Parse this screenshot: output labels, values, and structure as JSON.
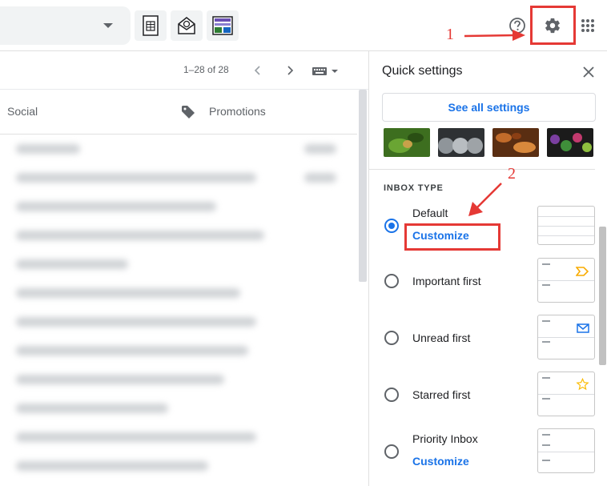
{
  "toolbar": {
    "pager_text": "1–28 of 28"
  },
  "tabs": [
    {
      "label": "Social"
    },
    {
      "label": "Promotions"
    }
  ],
  "quick_settings": {
    "title": "Quick settings",
    "see_all_label": "See all settings",
    "inbox_type_heading": "INBOX TYPE",
    "options": [
      {
        "label": "Default",
        "link": "Customize",
        "selected": true
      },
      {
        "label": "Important first",
        "selected": false
      },
      {
        "label": "Unread first",
        "selected": false
      },
      {
        "label": "Starred first",
        "selected": false
      },
      {
        "label": "Priority Inbox",
        "link": "Customize",
        "selected": false
      }
    ]
  },
  "annotations": {
    "step1": "1",
    "step2": "2"
  },
  "colors": {
    "accent": "#1a73e8",
    "highlight": "#e53935",
    "important_marker": "#f9ab00",
    "star": "#fbbc04"
  }
}
